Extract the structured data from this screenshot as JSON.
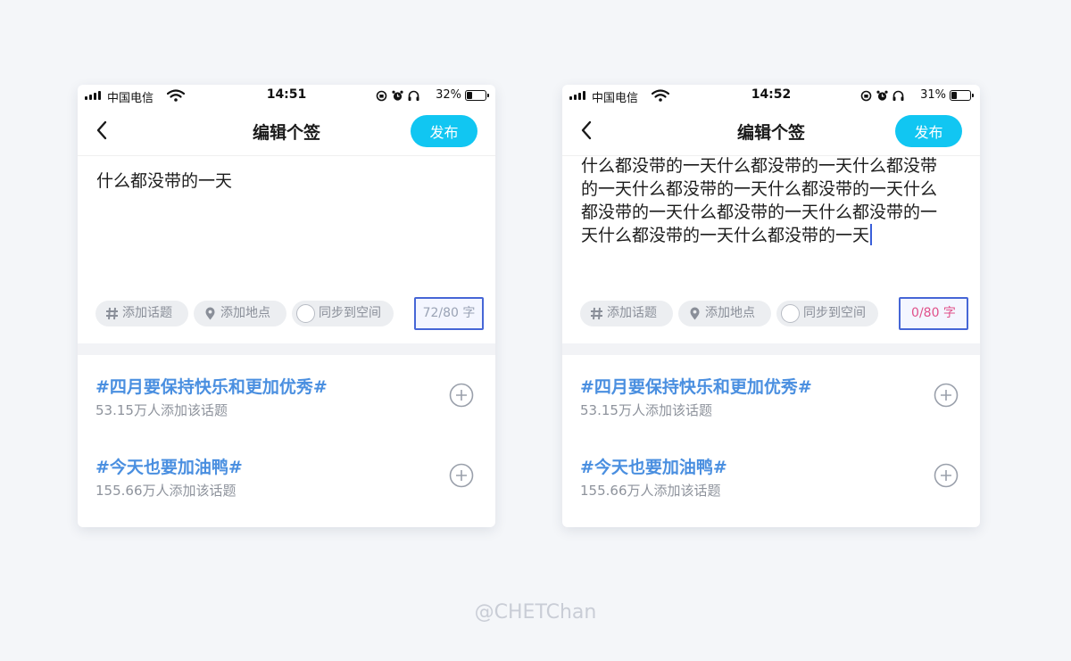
{
  "screens": [
    {
      "status": {
        "carrier": "中国电信",
        "time": "14:51",
        "battery_pct": "32%",
        "battery_level": 0.32
      },
      "nav": {
        "title": "编辑个签",
        "publish_label": "发布"
      },
      "editor": {
        "text": "什么都没带的一天",
        "show_caret": false
      },
      "chips": {
        "topic": "添加话题",
        "location": "添加地点",
        "sync": "同步到空间"
      },
      "counter": "72/80 字",
      "topics": [
        {
          "title": "#四月要保持快乐和更加优秀#",
          "count": "53.15万人添加该话题"
        },
        {
          "title": "#今天也要加油鸭#",
          "count": "155.66万人添加该话题"
        }
      ]
    },
    {
      "status": {
        "carrier": "中国电信",
        "time": "14:52",
        "battery_pct": "31%",
        "battery_level": 0.31
      },
      "nav": {
        "title": "编辑个签",
        "publish_label": "发布"
      },
      "editor": {
        "text": "什么都没带的一天什么都没带的一天什么都没带的一天什么都没带的一天什么都没带的一天什么都没带的一天什么都没带的一天什么都没带的一天什么都没带的一天什么都没带的一天",
        "show_caret": true
      },
      "chips": {
        "topic": "添加话题",
        "location": "添加地点",
        "sync": "同步到空间"
      },
      "counter": "0/80 字",
      "topics": [
        {
          "title": "#四月要保持快乐和更加优秀#",
          "count": "53.15万人添加该话题"
        },
        {
          "title": "#今天也要加油鸭#",
          "count": "155.66万人添加该话题"
        }
      ]
    }
  ],
  "colors": {
    "accent": "#11c6f2",
    "topic_link": "#4a8fe0",
    "counter_focus_border": "#4666d6",
    "counter_limit_text": "#e0508a"
  },
  "icons": {
    "status": [
      "signal-icon",
      "wifi-icon",
      "orientation-lock-icon",
      "alarm-icon",
      "headphones-icon",
      "battery-icon"
    ],
    "nav": "back-chevron-icon",
    "chips": [
      "hashtag-icon",
      "location-pin-icon",
      "radio-circle-icon"
    ],
    "topic_action": "plus-circle-icon"
  },
  "watermark": "@CHETChan"
}
